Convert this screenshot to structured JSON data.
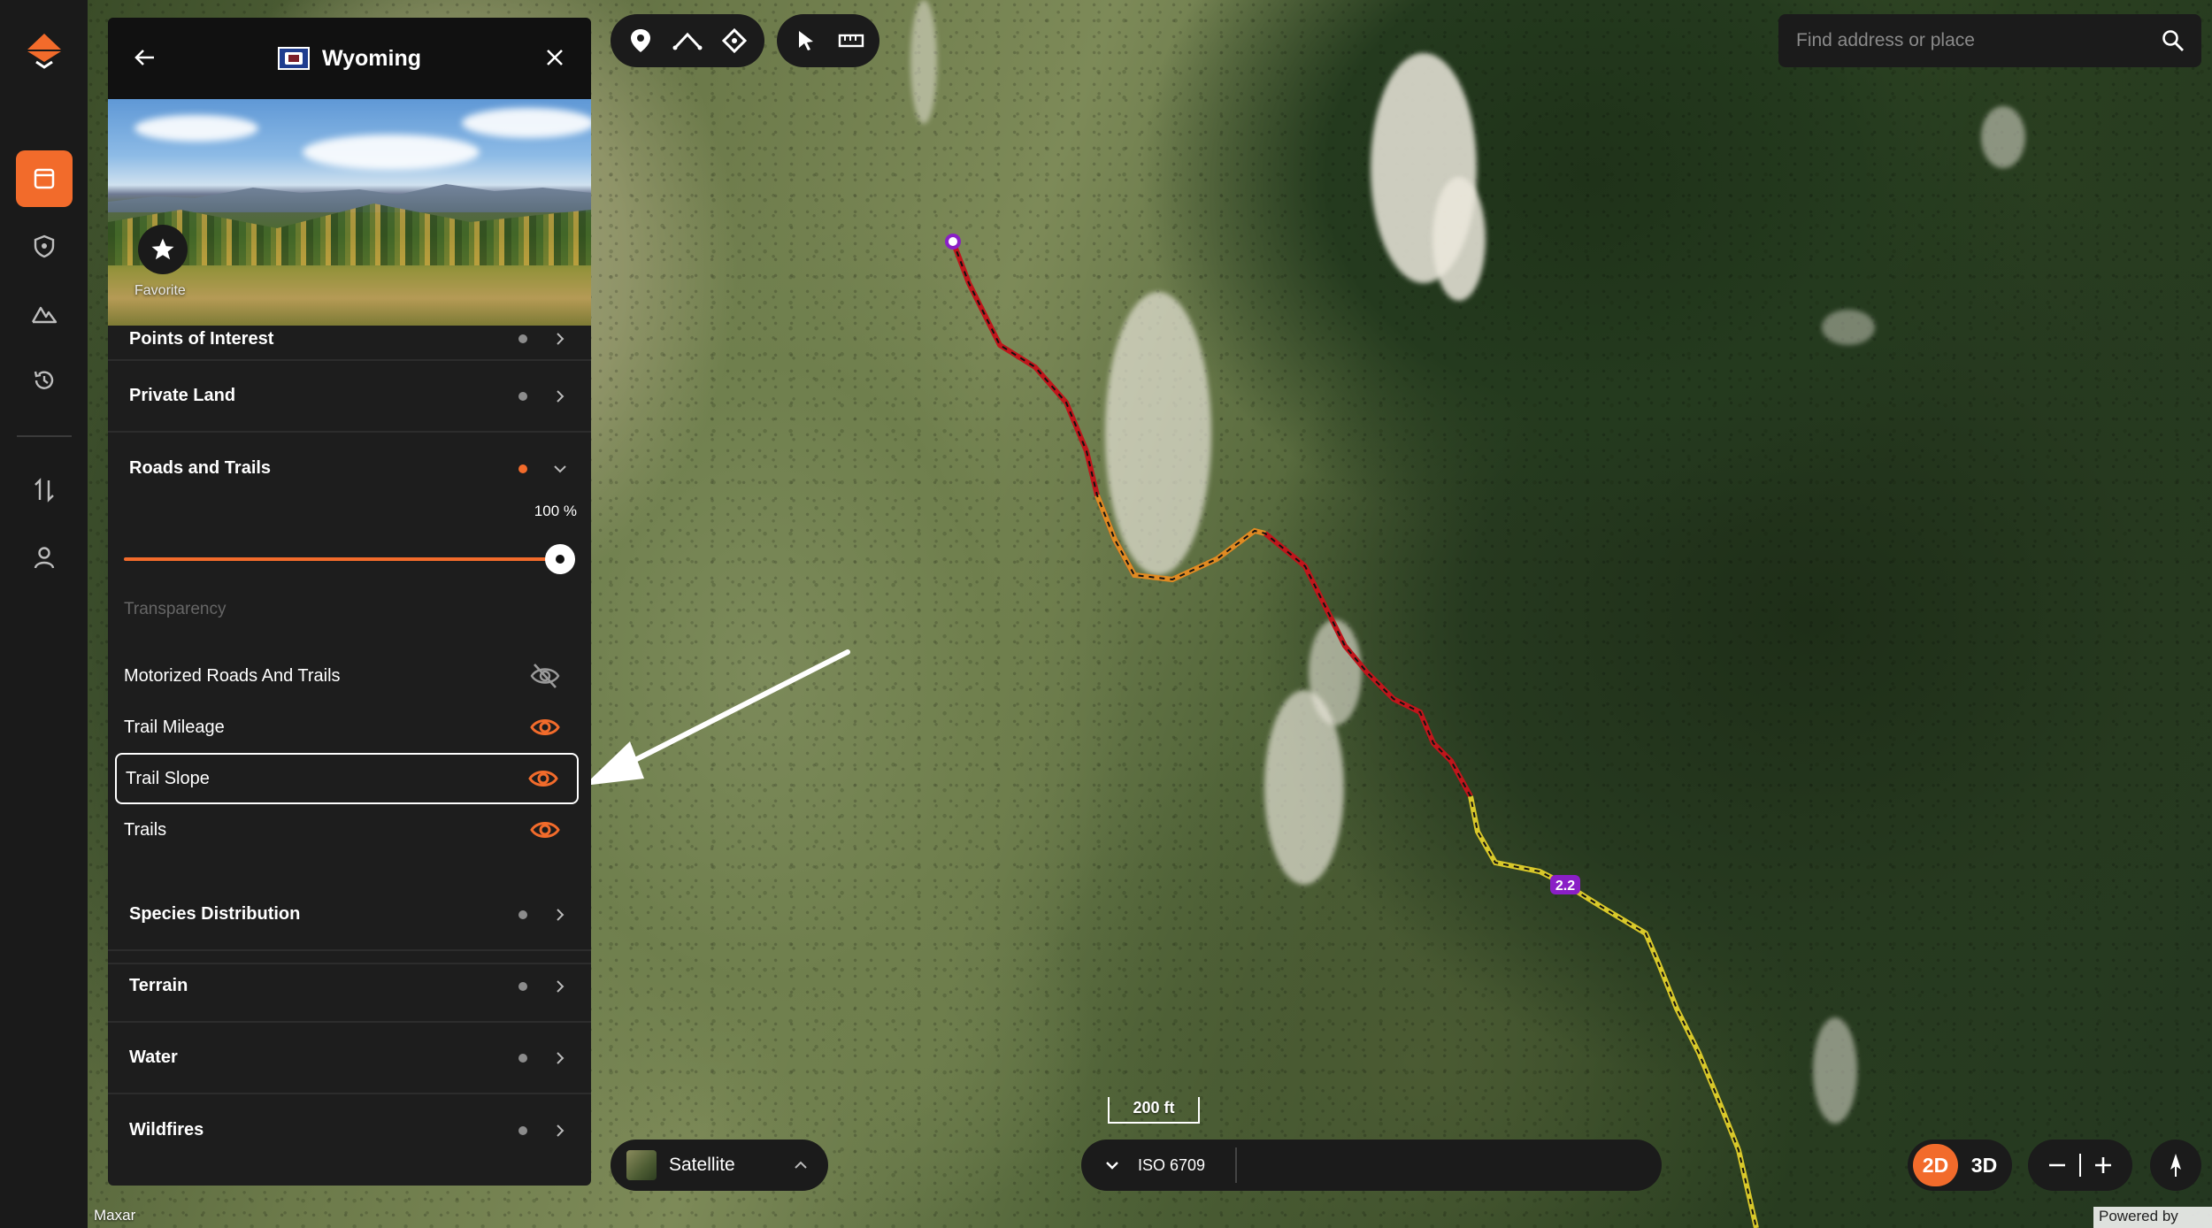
{
  "panel": {
    "title": "Wyoming",
    "favorite_label": "Favorite",
    "categories_top": [
      {
        "label": "Points of Interest",
        "active": false
      },
      {
        "label": "Private Land",
        "active": false
      },
      {
        "label": "Roads and Trails",
        "active": true
      }
    ],
    "roads_and_trails": {
      "opacity_value": "100 %",
      "opacity_fraction": 1.0,
      "transparency_label": "Transparency",
      "layers": [
        {
          "label": "Motorized Roads And Trails",
          "visible": false
        },
        {
          "label": "Trail Mileage",
          "visible": true
        },
        {
          "label": "Trail Slope",
          "visible": true,
          "highlighted": true
        },
        {
          "label": "Trails",
          "visible": true
        }
      ]
    },
    "categories_bottom": [
      {
        "label": "Species Distribution",
        "active": false
      },
      {
        "label": "Terrain",
        "active": false
      },
      {
        "label": "Water",
        "active": false
      },
      {
        "label": "Wildfires",
        "active": false
      }
    ]
  },
  "search": {
    "placeholder": "Find address or place"
  },
  "basemap": {
    "label": "Satellite"
  },
  "scale": {
    "label": "200 ft"
  },
  "grid": {
    "label": "ISO 6709"
  },
  "dimension": {
    "two_d": "2D",
    "three_d": "3D",
    "active": "2D"
  },
  "map": {
    "trail_marker_label": "2.2"
  },
  "attribution": {
    "left": "Maxar",
    "right": "Powered by Esri"
  },
  "colors": {
    "accent": "#f26b2b",
    "panel_bg": "#1d1d1d",
    "rail_bg": "#1a1a1a",
    "trail_red": "#c0151b",
    "trail_orange": "#e08a22",
    "trail_yellow": "#d8c82a",
    "marker_purple": "#8a1fc6"
  },
  "icons": {
    "rail": [
      "onx-logo-icon",
      "layers-icon",
      "shield-icon",
      "mountain-icon",
      "history-icon",
      "transfer-icon",
      "user-icon"
    ],
    "toolbar": [
      "waypoint-icon",
      "line-icon",
      "crosshair-icon",
      "pointer-icon",
      "ruler-icon"
    ]
  }
}
